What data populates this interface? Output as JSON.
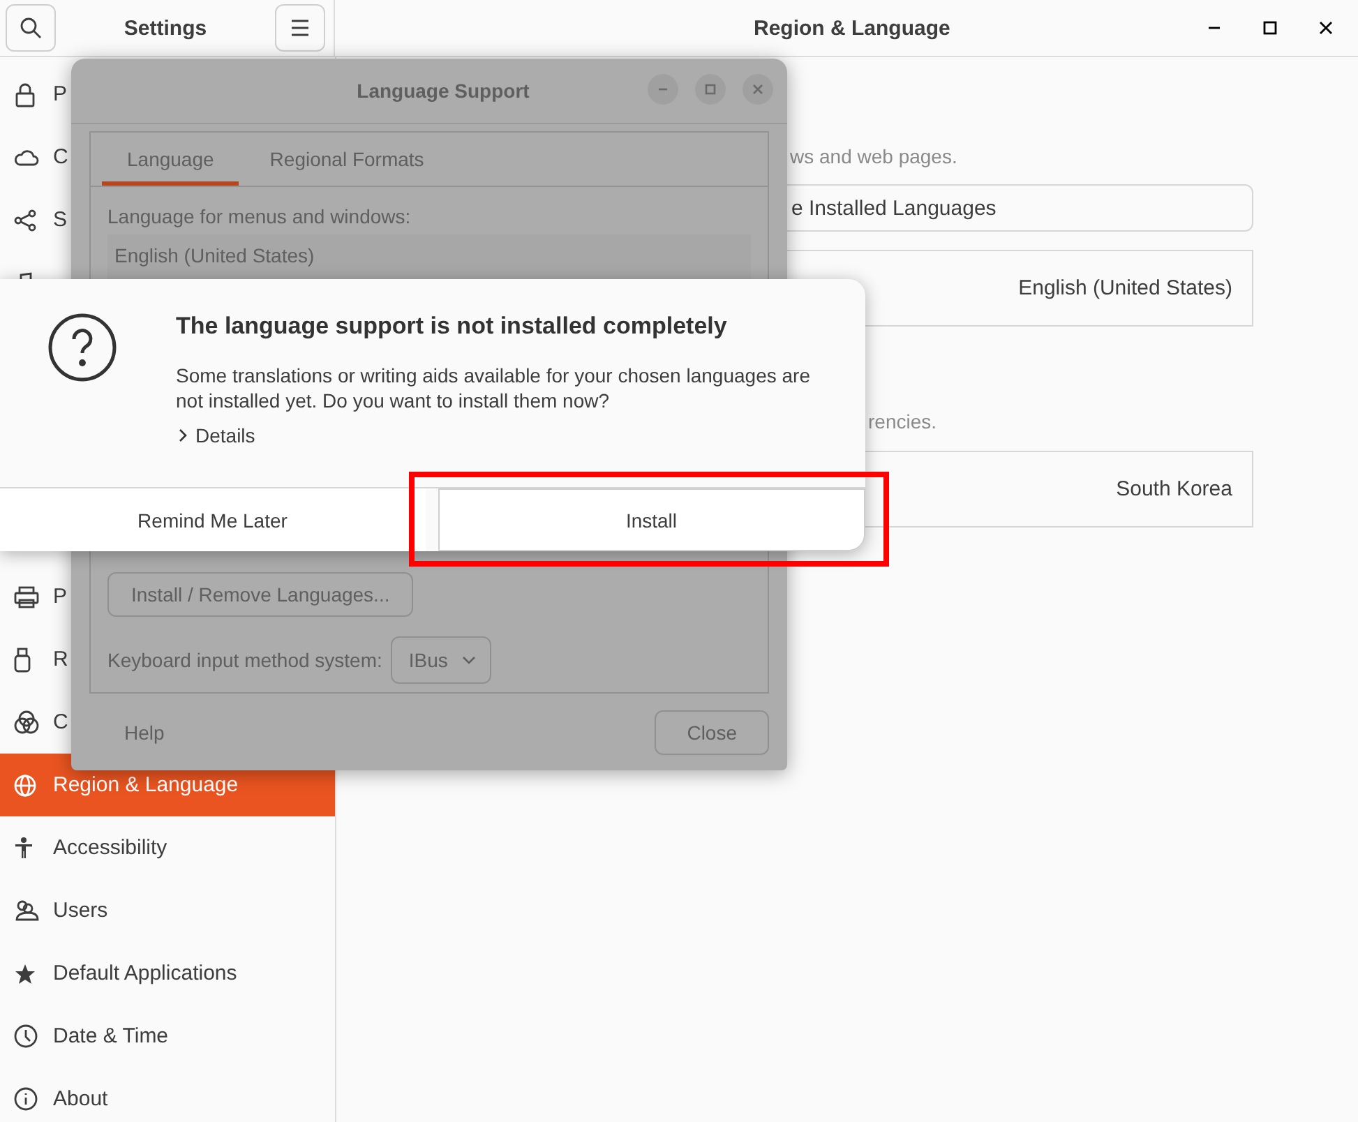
{
  "settings": {
    "title": "Settings",
    "page_title": "Region & Language"
  },
  "sidebar": {
    "top_items": [
      {
        "label": "P",
        "selected": false
      },
      {
        "label": "C",
        "selected": false
      },
      {
        "label": "S",
        "selected": false
      },
      {
        "selected": false
      }
    ],
    "bottom_items": [
      {
        "label": "P",
        "selected": false
      },
      {
        "label": "R",
        "selected": false
      },
      {
        "label": "C",
        "selected": false
      },
      {
        "label": "Region & Language",
        "selected": true
      },
      {
        "label": "Accessibility",
        "selected": false
      },
      {
        "label": "Users",
        "selected": false
      },
      {
        "label": "Default Applications",
        "selected": false
      },
      {
        "label": "Date & Time",
        "selected": false
      },
      {
        "label": "About",
        "selected": false
      }
    ]
  },
  "region_page": {
    "language_caption": "ws and web pages.",
    "manage_button": "e Installed Languages",
    "language_value": "English (United States)",
    "formats_caption": "rencies.",
    "formats_value": "South Korea"
  },
  "language_support": {
    "title": "Language Support",
    "tabs": [
      {
        "label": "Language",
        "selected": true
      },
      {
        "label": "Regional Formats",
        "selected": false
      }
    ],
    "list_label": "Language for menus and windows:",
    "languages": [
      "English (United States)"
    ],
    "install_button": "Install / Remove Languages...",
    "input_method_label": "Keyboard input method system:",
    "input_method": "IBus",
    "help_button": "Help",
    "close_button": "Close"
  },
  "alert": {
    "title": "The language support is not installed completely",
    "message": "Some translations or writing aids available for your chosen languages are not installed yet. Do you want to install them now?",
    "details": "Details",
    "expanded": false,
    "buttons": [
      {
        "label": "Remind Me Later",
        "focused": false
      },
      {
        "label": "Install",
        "focused": true
      }
    ]
  }
}
